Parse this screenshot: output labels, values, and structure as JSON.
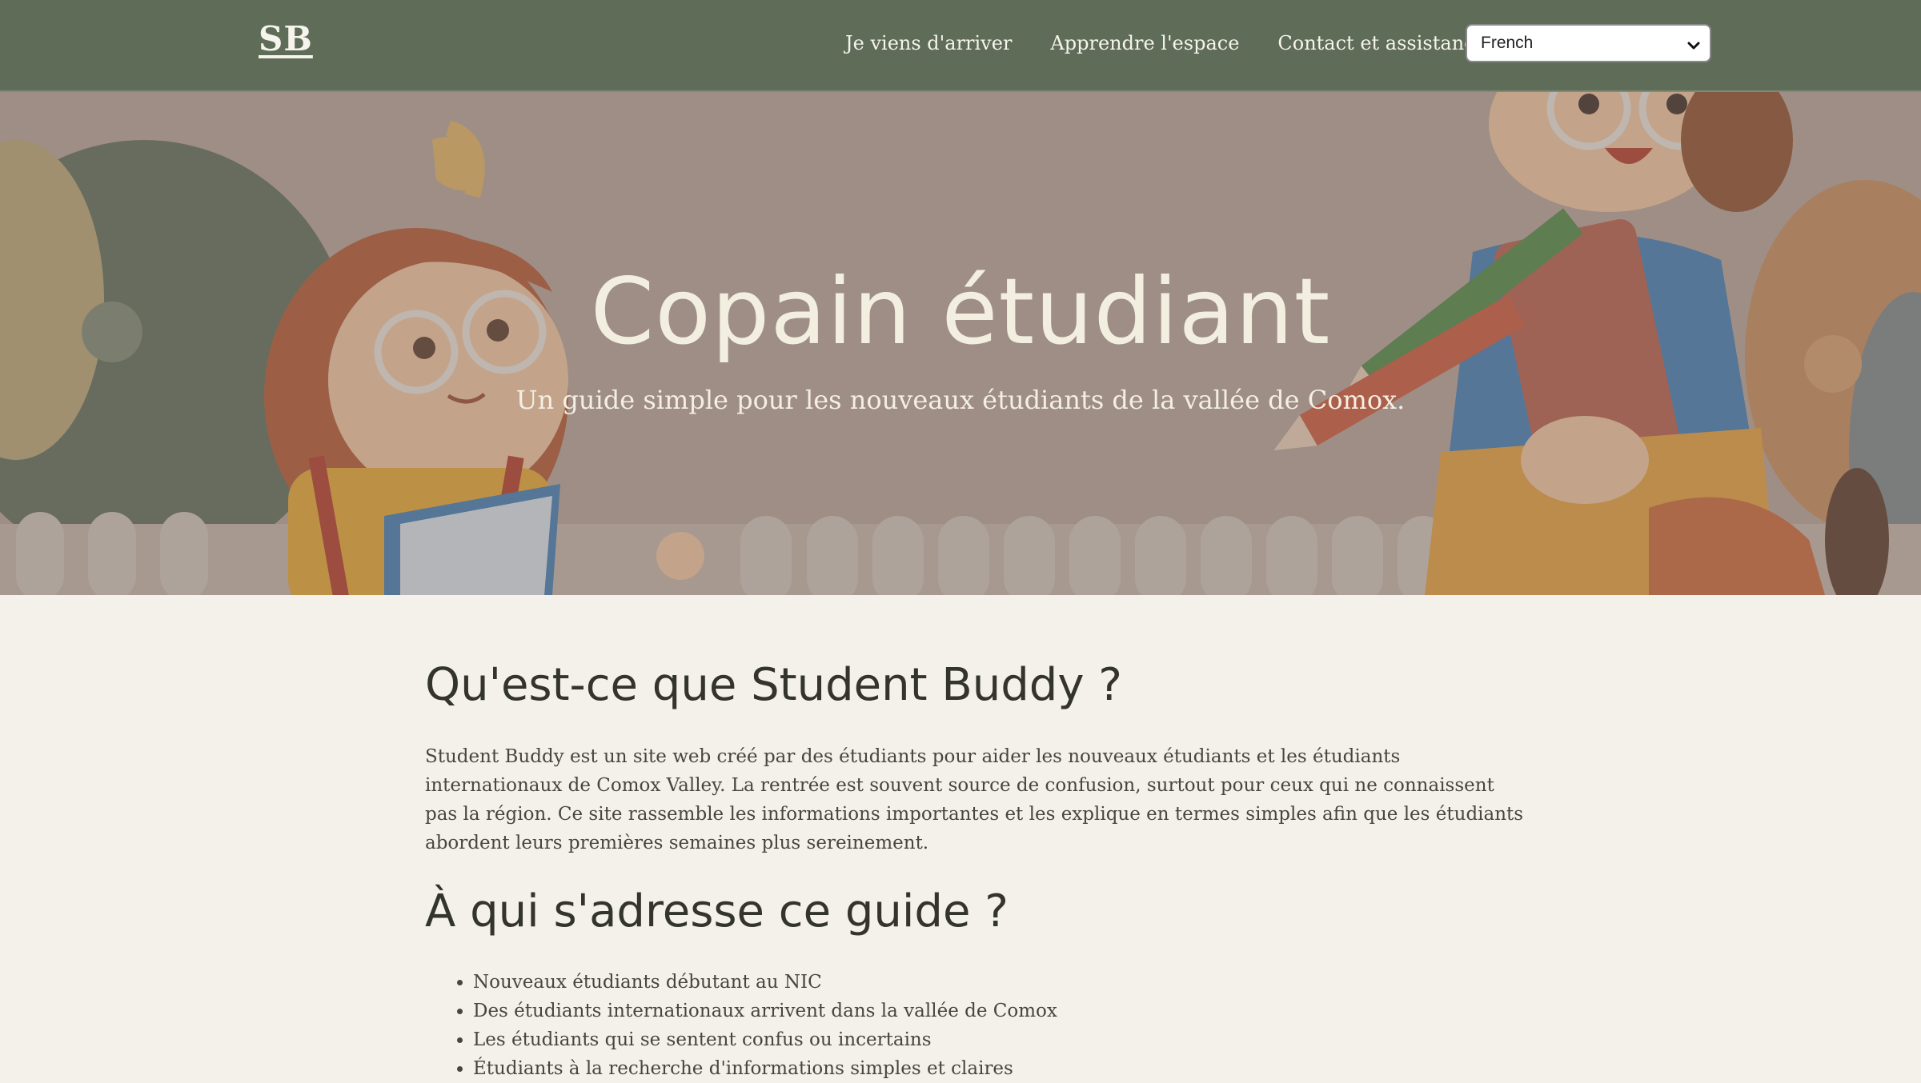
{
  "header": {
    "logo": "SB",
    "nav": [
      {
        "label": "Je viens d'arriver"
      },
      {
        "label": "Apprendre l'espace"
      },
      {
        "label": "Contact et assistance"
      }
    ],
    "language_select": {
      "value": "French"
    }
  },
  "hero": {
    "title": "Copain étudiant",
    "subtitle": "Un guide simple pour les nouveaux étudiants de la vallée de Comox."
  },
  "about": {
    "title": "Qu'est-ce que Student Buddy ?",
    "text": "Student Buddy est un site web créé par des étudiants pour aider les nouveaux étudiants et les étudiants internationaux de Comox Valley. La rentrée est souvent source de confusion, surtout pour ceux qui ne connaissent pas la région. Ce site rassemble les informations importantes et les explique en termes simples afin que les étudiants abordent leurs premières semaines plus sereinement."
  },
  "audience": {
    "title": "À qui s'adresse ce guide ?",
    "items": [
      "Nouveaux étudiants débutant au NIC",
      "Des étudiants internationaux arrivent dans la vallée de Comox",
      "Les étudiants qui se sentent confus ou incertains",
      "Étudiants à la recherche d'informations simples et claires"
    ]
  },
  "colors": {
    "header_bg": "#5f6c58",
    "page_bg": "#f3f1ea",
    "hero_text": "#f2eee0"
  }
}
